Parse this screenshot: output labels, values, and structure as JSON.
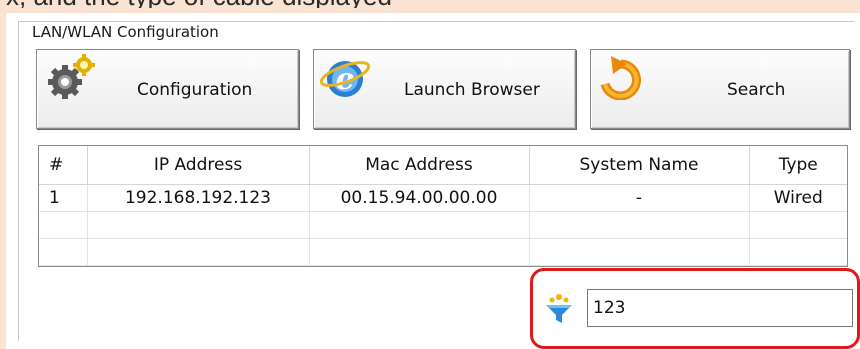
{
  "header_fragment": "x, and the type of cable displayed",
  "group": {
    "title": "LAN/WLAN Configuration"
  },
  "toolbar": {
    "configuration_label": "Configuration",
    "launch_browser_label": "Launch Browser",
    "search_label": "Search"
  },
  "table": {
    "columns": [
      "#",
      "IP Address",
      "Mac Address",
      "System Name",
      "Type"
    ],
    "rows": [
      [
        "1",
        "192.168.192.123",
        "00.15.94.00.00.00",
        "-",
        "Wired"
      ],
      [
        "",
        "",
        "",
        "",
        ""
      ],
      [
        "",
        "",
        "",
        "",
        ""
      ]
    ]
  },
  "filter": {
    "value": "123"
  },
  "colors": {
    "highlight": "#e01818",
    "background": "#fbe3d3"
  },
  "icons": [
    "gears-icon",
    "browser-icon",
    "search-arrow-icon",
    "filter-icon"
  ]
}
